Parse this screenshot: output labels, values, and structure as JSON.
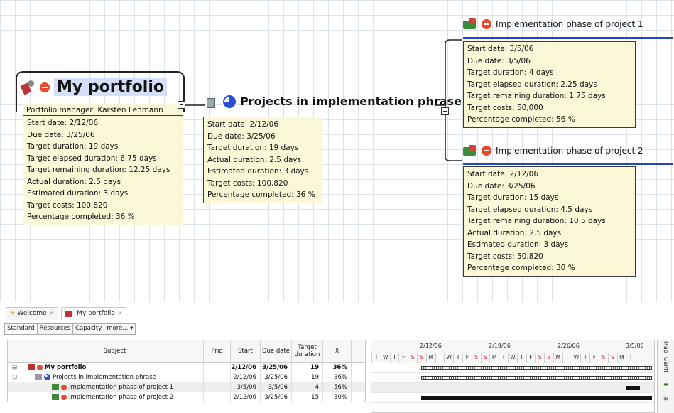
{
  "mindmap": {
    "portfolio": {
      "title": "My portfolio",
      "manager": "Portfolio manager: Karsten Lehmann",
      "details": [
        "Start date: 2/12/06",
        "Due date: 3/25/06",
        "Target duration: 19 days",
        "Target elapsed duration: 6.75 days",
        "Target remaining duration: 12.25 days",
        "Actual duration: 2.5 days",
        "Estimated duration: 3 days",
        "Target costs: 100,820",
        "Percentage completed: 36 %"
      ]
    },
    "projects": {
      "title": "Projects in implementation phrase",
      "details": [
        "Start date: 2/12/06",
        "Due date: 3/25/06",
        "Target duration: 19 days",
        "Actual duration: 2.5 days",
        "Estimated duration: 3 days",
        "Target costs: 100,820",
        "Percentage completed: 36 %"
      ]
    },
    "impl1": {
      "title": "Implementation phase of project 1",
      "details": [
        "Start date: 3/5/06",
        "Due date: 3/5/06",
        "Target duration: 4 days",
        "Target elapsed duration: 2.25 days",
        "Target remaining duration: 1.75 days",
        "Target costs: 50,000",
        "Percentage completed: 56 %"
      ]
    },
    "impl2": {
      "title": "Implementation phase of project 2",
      "details": [
        "Start date: 2/12/06",
        "Due date: 3/25/06",
        "Target duration: 15 days",
        "Target elapsed duration: 4.5 days",
        "Target remaining duration: 10.5 days",
        "Actual duration: 2.5 days",
        "Estimated duration: 3 days",
        "Target costs: 50,820",
        "Percentage completed: 30 %"
      ]
    }
  },
  "tabs": [
    {
      "label": "Welcome",
      "close": "×"
    },
    {
      "label": "My portfolio",
      "close": "×"
    }
  ],
  "view_tabs": [
    "Standard",
    "Resources",
    "Capacity",
    "more... ▾"
  ],
  "table": {
    "headers": [
      "Subject",
      "Prio",
      "Start",
      "Due date",
      "Target duration",
      "%"
    ],
    "rows": [
      {
        "subject": "My portfolio",
        "prio": "",
        "start": "2/12/06",
        "due": "3/25/06",
        "duration": "19",
        "pct": "36%"
      },
      {
        "subject": "Projects in implementation phrase",
        "prio": "",
        "start": "2/12/06",
        "due": "3/25/06",
        "duration": "19",
        "pct": "36%"
      },
      {
        "subject": "Implementation phase of project 1",
        "prio": "",
        "start": "3/5/06",
        "due": "3/5/06",
        "duration": "4",
        "pct": "56%"
      },
      {
        "subject": "Implementation phase of project 2",
        "prio": "",
        "start": "2/12/06",
        "due": "3/25/06",
        "duration": "15",
        "pct": "30%"
      }
    ]
  },
  "gantt": {
    "weeks": [
      "2/12/06",
      "2/19/06",
      "2/26/06",
      "3/5/06"
    ],
    "days": [
      "T",
      "W",
      "T",
      "F",
      "S",
      "S",
      "M",
      "T",
      "W",
      "T",
      "F",
      "S",
      "S",
      "M",
      "T",
      "W",
      "T",
      "F",
      "S",
      "S",
      "M",
      "T",
      "W",
      "T",
      "F",
      "S",
      "S",
      "M",
      "T"
    ]
  },
  "sidebar": {
    "map_label": "Map",
    "gantt_label": "Gantt"
  },
  "colors": {
    "accent": "#2542c8",
    "note_bg": "#fbf8d8",
    "status_red": "#e84a2a"
  }
}
